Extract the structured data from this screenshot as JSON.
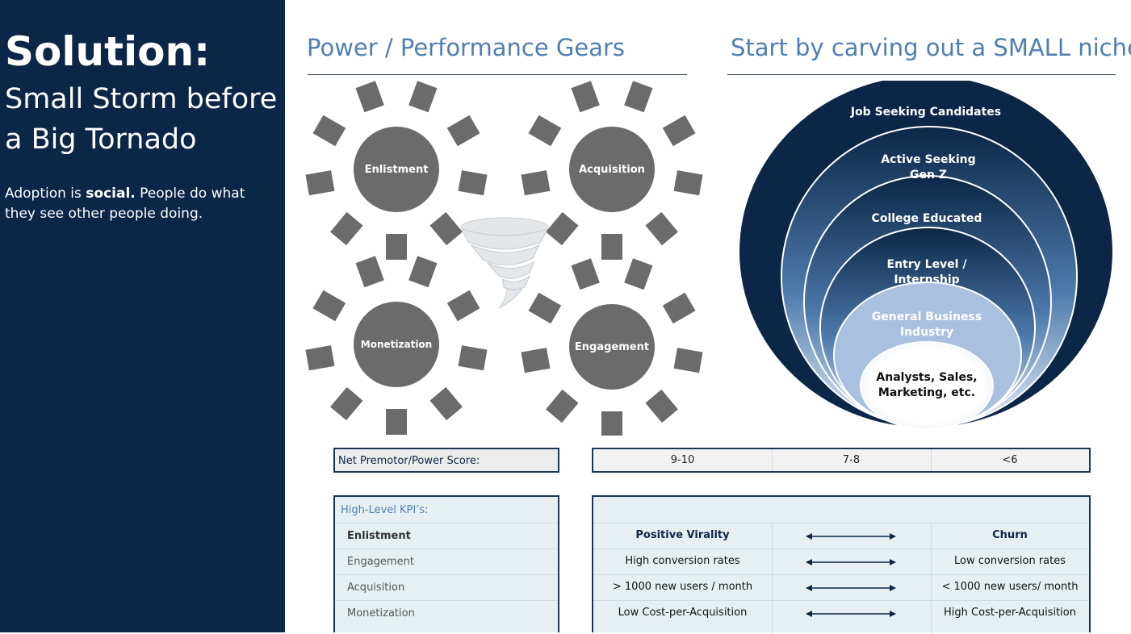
{
  "sidebar": {
    "title": "Solution:",
    "subtitle_line1": "Small Storm before",
    "subtitle_line2": "a Big Tornado",
    "body_pre": "Adoption is ",
    "body_bold": "social.",
    "body_post": " People do what they see other people doing."
  },
  "left_heading": "Power / Performance Gears",
  "right_heading": "Start by carving out a SMALL niche",
  "gears": [
    {
      "label": "Enlistment"
    },
    {
      "label": "Acquisition"
    },
    {
      "label": "Monetization"
    },
    {
      "label": "Engagement"
    }
  ],
  "niche_levels": [
    {
      "line1": "Job Seeking Candidates",
      "line2": ""
    },
    {
      "line1": "Active Seeking",
      "line2": "Gen Z"
    },
    {
      "line1": "College Educated",
      "line2": ""
    },
    {
      "line1": "Entry Level /",
      "line2": "Internship"
    },
    {
      "line1": "General Business",
      "line2": "Industry"
    },
    {
      "line1": "Analysts, Sales,",
      "line2": "Marketing, etc."
    }
  ],
  "nps": {
    "label": "Net Premotor/Power Score:",
    "high": "9-10",
    "mid": "7-8",
    "low": "<6"
  },
  "kpi": {
    "header": "High-Level KPI’s:",
    "rows": [
      {
        "name": "Enlistment",
        "positive": "Positive Virality",
        "negative": "Churn"
      },
      {
        "name": "Engagement",
        "positive": "High conversion rates",
        "negative": "Low conversion rates"
      },
      {
        "name": "Acquisition",
        "positive": "> 1000 new users / month",
        "negative": "< 1000 new users/ month"
      },
      {
        "name": "Monetization",
        "positive": "Low Cost-per-Acquisition",
        "negative": "High Cost-per-Acquisition"
      }
    ]
  },
  "colors": {
    "sidebar": "#0c2647",
    "heading": "#4f7fb1",
    "gear": "#6b6b6b",
    "kpi_bg": "#e6f0f2"
  }
}
